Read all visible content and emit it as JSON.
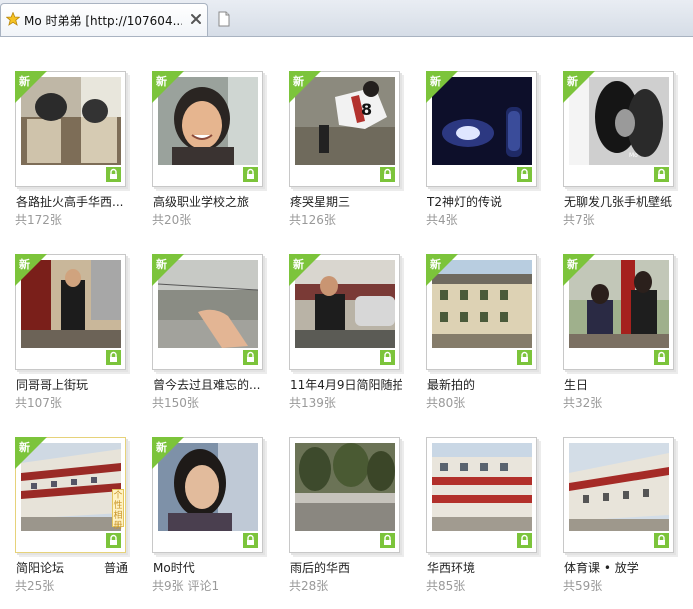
{
  "tab": {
    "title": "Mo 时弟弟 [http://107604...",
    "favicon": "star-icon",
    "close_icon": "close-icon",
    "new_tab_icon": "page-icon"
  },
  "colors": {
    "new_badge": "#7cc43b",
    "lock": "#7cc43b",
    "count_text": "#999999"
  },
  "badge_text": "新",
  "albums": [
    {
      "name": "各路扯火高手华西...",
      "count": "共172张",
      "is_new": true
    },
    {
      "name": "高级职业学校之旅",
      "count": "共20张",
      "is_new": true
    },
    {
      "name": "疼哭星期三",
      "count": "共126张",
      "is_new": true
    },
    {
      "name": "T2神灯的传说",
      "count": "共4张",
      "is_new": true
    },
    {
      "name": "无聊发几张手机壁纸",
      "count": "共7张",
      "is_new": true
    },
    {
      "name": "同哥哥上街玩",
      "count": "共107张",
      "is_new": true
    },
    {
      "name": "曾今去过且难忘的...",
      "count": "共150张",
      "is_new": true
    },
    {
      "name": "11年4月9日简阳随拍",
      "count": "共139张",
      "is_new": true
    },
    {
      "name": "最新拍的",
      "count": "共80张",
      "is_new": true
    },
    {
      "name": "生日",
      "count": "共32张",
      "is_new": true
    },
    {
      "name": "简阳论坛",
      "count": "共25张",
      "is_new": true,
      "extra": "普通",
      "side_badge": "个性相册"
    },
    {
      "name": "Mo时代",
      "count": "共9张   评论1",
      "is_new": true
    },
    {
      "name": "雨后的华西",
      "count": "共28张",
      "is_new": false
    },
    {
      "name": "华西环境",
      "count": "共85张",
      "is_new": false
    },
    {
      "name": "体育课 • 放学",
      "count": "共59张",
      "is_new": false
    }
  ]
}
